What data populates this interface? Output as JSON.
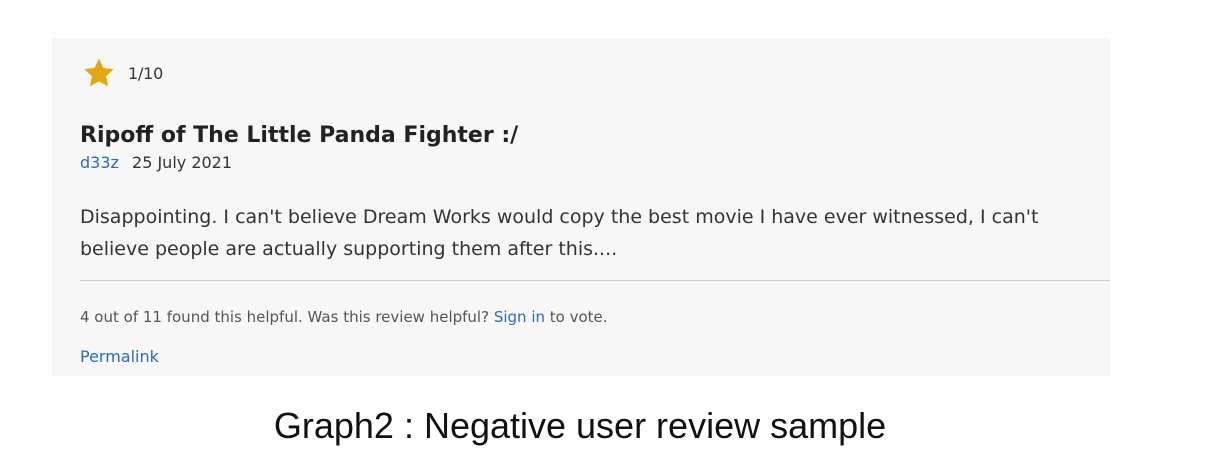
{
  "review": {
    "rating_icon": "star-icon",
    "rating_text": "1/10",
    "star_color": "#E3A712",
    "title": "Ripoff of The Little Panda Fighter :/",
    "author": "d33z",
    "date": "25 July 2021",
    "body": "Disappointing. I can't believe Dream Works would copy the best movie I have ever witnessed, I can't believe people are actually supporting them after this....",
    "helpful": {
      "prefix": "4 out of 11 found this helpful. Was this review helpful?",
      "sign_in": "Sign in",
      "suffix": "to vote."
    },
    "permalink": "Permalink"
  },
  "caption": "Graph2 : Negative user review sample",
  "colors": {
    "link": "#2B6CB0",
    "card_bg": "#F7F7F7"
  }
}
